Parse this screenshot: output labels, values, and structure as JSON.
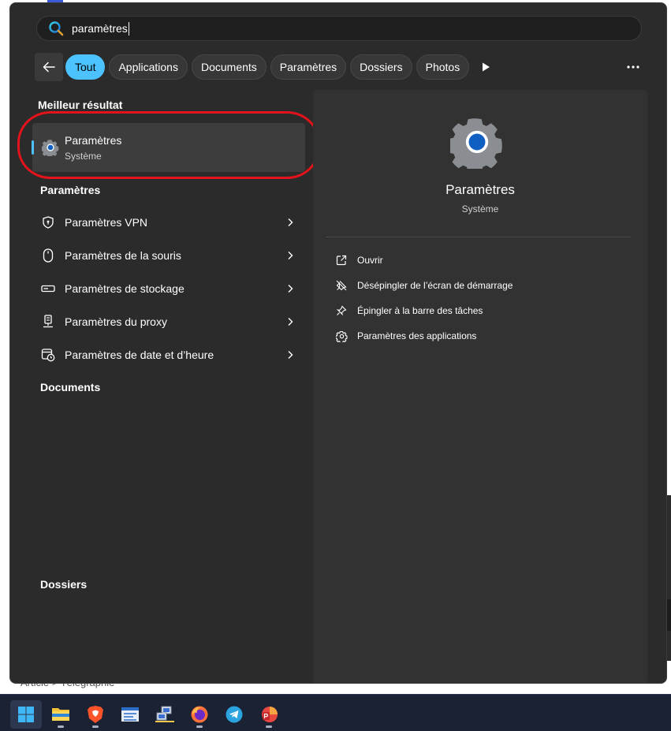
{
  "search": {
    "query": "paramètres"
  },
  "filters": [
    {
      "label": "Tout",
      "active": true
    },
    {
      "label": "Applications",
      "active": false
    },
    {
      "label": "Documents",
      "active": false
    },
    {
      "label": "Paramètres",
      "active": false
    },
    {
      "label": "Dossiers",
      "active": false
    },
    {
      "label": "Photos",
      "active": false
    }
  ],
  "sections": {
    "best_match": "Meilleur résultat",
    "settings": "Paramètres",
    "documents": "Documents",
    "folders": "Dossiers"
  },
  "best_result": {
    "name": "Paramètres",
    "subtitle": "Système",
    "icon": "gear-icon"
  },
  "settings_items": [
    {
      "label": "Paramètres VPN",
      "icon": "vpn-shield-icon"
    },
    {
      "label": "Paramètres de la souris",
      "icon": "mouse-icon"
    },
    {
      "label": "Paramètres de stockage",
      "icon": "storage-icon"
    },
    {
      "label": "Paramètres du proxy",
      "icon": "proxy-icon"
    },
    {
      "label": "Paramètres de date et d’heure",
      "icon": "date-time-icon"
    }
  ],
  "preview": {
    "title": "Paramètres",
    "subtitle": "Système",
    "actions": [
      {
        "label": "Ouvrir",
        "icon": "open-external-icon"
      },
      {
        "label": "Désépingler de l’écran de démarrage",
        "icon": "unpin-icon"
      },
      {
        "label": "Épingler à la barre des tâches",
        "icon": "pin-icon"
      },
      {
        "label": "Paramètres des applications",
        "icon": "gear-icon"
      }
    ]
  },
  "background": {
    "breadcrumb": "Article  >  Télégraphie"
  },
  "taskbar": {
    "apps": [
      "windows-start-icon",
      "file-explorer-icon",
      "brave-browser-icon",
      "word-editor-icon",
      "network-computer-icon",
      "firefox-icon",
      "telegram-icon",
      "pdf-reader-icon"
    ]
  },
  "colors": {
    "accent": "#4cc2ff",
    "highlight": "#e3131b",
    "panel": "#2b2b2b"
  }
}
